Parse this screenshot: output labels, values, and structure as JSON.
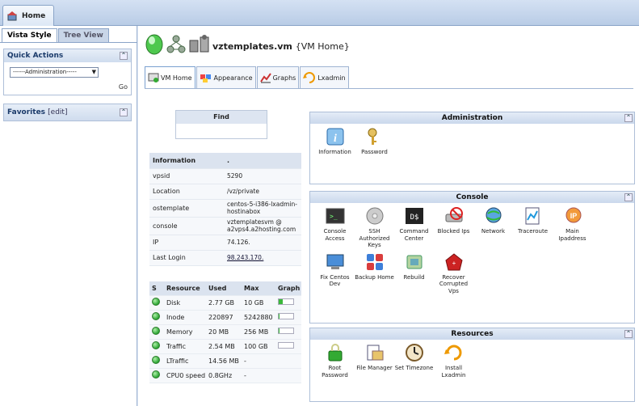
{
  "topbar": {
    "home_tab": "Home"
  },
  "sidebar": {
    "tabs": [
      "Vista Style",
      "Tree View"
    ],
    "quick_actions": {
      "title": "Quick Actions",
      "select_value": "------Administration-----",
      "go": "Go"
    },
    "favorites": {
      "title": "Favorites",
      "edit": "[edit]"
    }
  },
  "header": {
    "vm_name": "vztemplates.vm",
    "vm_sub": "{VM Home}"
  },
  "tabs": [
    "VM Home",
    "Appearance",
    "Graphs",
    "Lxadmin"
  ],
  "find": {
    "title": "Find"
  },
  "information": {
    "headers": [
      "Information",
      "."
    ],
    "rows": [
      {
        "label": "vpsid",
        "value": "5290"
      },
      {
        "label": "Location",
        "value": "/vz/private"
      },
      {
        "label": "ostemplate",
        "value": "centos-5-i386-lxadmin-hostinabox"
      },
      {
        "label": "console",
        "value": "vztemplatesvm @ a2vps4.a2hosting.com"
      },
      {
        "label": "IP",
        "value": "74.126."
      },
      {
        "label": "Last Login",
        "value": "98.243.170."
      }
    ]
  },
  "resources_table": {
    "headers": [
      "S",
      "Resource",
      "Used",
      "Max",
      "Graph"
    ],
    "rows": [
      {
        "name": "Disk",
        "used": "2.77 GB",
        "max": "10 GB",
        "fill": 0.28
      },
      {
        "name": "Inode",
        "used": "220897",
        "max": "5242880",
        "fill": 0.04
      },
      {
        "name": "Memory",
        "used": "20 MB",
        "max": "256 MB",
        "fill": 0.08
      },
      {
        "name": "Traffic",
        "used": "2.54 MB",
        "max": "100 GB",
        "fill": 0.0
      },
      {
        "name": "LTraffic",
        "used": "14.56 MB",
        "max": "-",
        "fill": null
      },
      {
        "name": "CPU0 speed",
        "used": "0.8GHz",
        "max": "-",
        "fill": null
      }
    ]
  },
  "panels": {
    "administration": {
      "title": "Administration",
      "items": [
        "Information",
        "Password"
      ]
    },
    "console": {
      "title": "Console",
      "items": [
        "Console Access",
        "SSH Authorized Keys",
        "Command Center",
        "Blocked Ips",
        "Network",
        "Traceroute",
        "Main Ipaddress",
        "Fix Centos Dev",
        "Backup Home",
        "Rebuild",
        "Recover Corrupted Vps"
      ]
    },
    "resources": {
      "title": "Resources",
      "items": [
        "Root Password",
        "File Manager",
        "Set Timezone",
        "Install Lxadmin"
      ]
    }
  },
  "colors": {
    "accent": "#1a3a6a",
    "panel_header": "#cad8ec",
    "status_green": "#2aa432"
  }
}
